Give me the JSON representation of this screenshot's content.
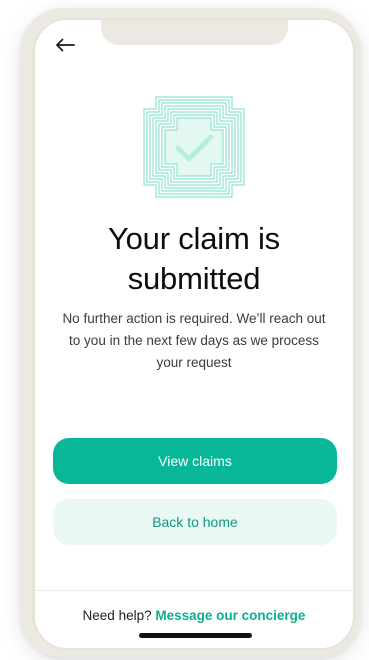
{
  "screen": {
    "title": "Your claim is submitted",
    "description": "No further action is required. We’ll reach out to you in the next few days as we process your request"
  },
  "actions": {
    "primary_label": "View claims",
    "secondary_label": "Back to home"
  },
  "footer": {
    "help_text": "Need help?",
    "help_link": "Message our concierge"
  },
  "icons": {
    "back": "arrow-left-icon",
    "success": "check-badge-icon"
  },
  "colors": {
    "accent": "#08b797",
    "accent_light": "#e9f8f4",
    "text_primary": "#0d0d0d",
    "text_secondary": "#3b3b3b"
  }
}
